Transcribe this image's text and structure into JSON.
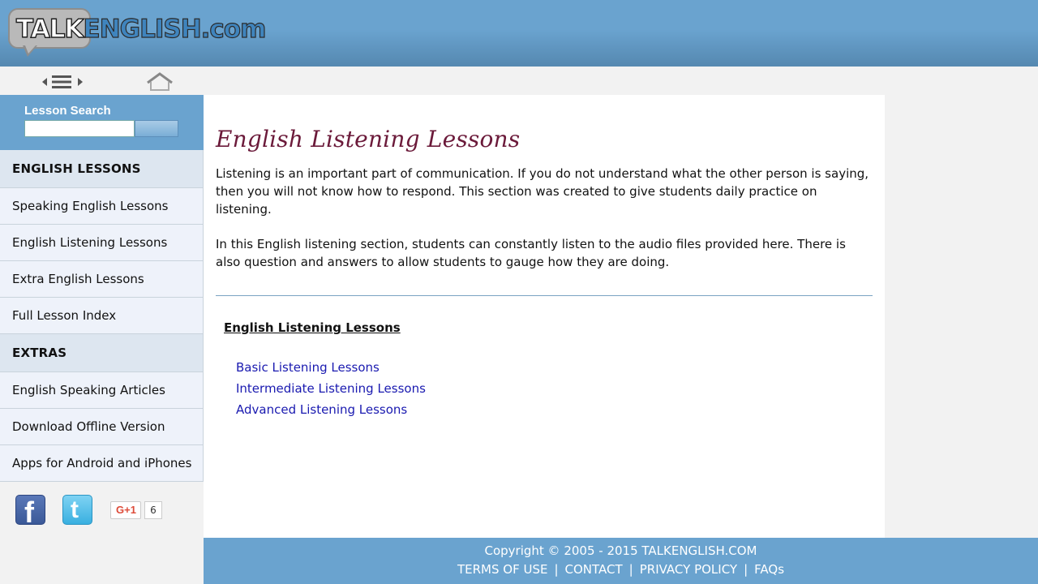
{
  "header": {
    "logo_left": "TALK",
    "logo_right": "ENGLISH.com"
  },
  "search": {
    "label": "Lesson Search",
    "value": "",
    "placeholder": ""
  },
  "sidebar": {
    "items": [
      {
        "label": "ENGLISH LESSONS",
        "section": true
      },
      {
        "label": "Speaking English Lessons",
        "section": false
      },
      {
        "label": "English Listening Lessons",
        "section": false
      },
      {
        "label": "Extra English Lessons",
        "section": false
      },
      {
        "label": "Full Lesson Index",
        "section": false
      },
      {
        "label": "EXTRAS",
        "section": true
      },
      {
        "label": "English Speaking Articles",
        "section": false
      },
      {
        "label": "Download Offline Version",
        "section": false
      },
      {
        "label": "Apps for Android and iPhones",
        "section": false
      }
    ]
  },
  "social": {
    "facebook_letter": "f",
    "twitter_letter": "t",
    "gplus_label": "G+1",
    "gplus_count": "6"
  },
  "main": {
    "title": "English Listening Lessons",
    "paragraph1": "Listening is an important part of communication. If you do not understand what the other person is saying, then you will not know how to respond. This section was created to give students daily practice on listening.",
    "paragraph2": "In this English listening section, students can constantly listen to the audio files provided here. There is also question and answers to allow students to gauge how they are doing.",
    "subheading": "English Listening Lessons",
    "links": [
      "Basic Listening Lessons",
      "Intermediate Listening Lessons",
      "Advanced Listening Lessons"
    ]
  },
  "footer": {
    "copyright": "Copyright © 2005 - 2015 TALKENGLISH.COM",
    "links": [
      "TERMS OF USE",
      "CONTACT",
      "PRIVACY POLICY",
      "FAQs"
    ],
    "separator": "|"
  },
  "colors": {
    "header_blue": "#6aa3cf",
    "title_maroon": "#6b1a3a",
    "link_blue": "#1a1ab0"
  }
}
